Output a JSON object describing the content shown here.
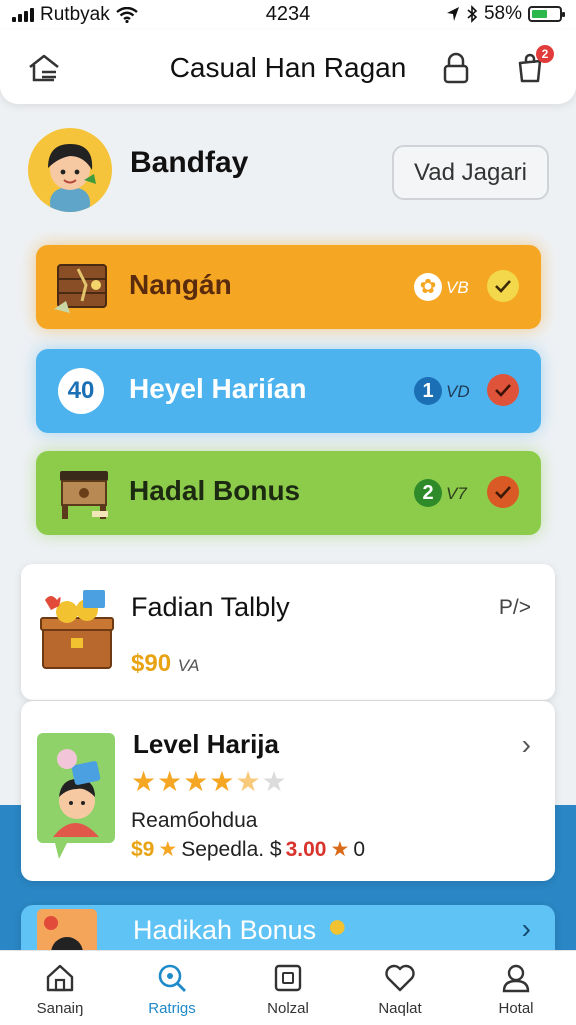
{
  "status_bar": {
    "carrier": "Rutbyak",
    "time": "4234",
    "battery": "58%",
    "battery_level": 0.58
  },
  "header": {
    "title": "Casual Han Ragan",
    "notification_count": "2"
  },
  "user": {
    "name": "Bandfay",
    "action_button": "Vad Jagari"
  },
  "quests": [
    {
      "label": "Nangán",
      "number": "",
      "suffix": "VB",
      "check_color": "#f2d84a",
      "color": "#f5a623"
    },
    {
      "label": "Heyel Hariían",
      "badge": "40",
      "number": "1",
      "suffix": "VD",
      "check_color": "#e0533b",
      "color": "#4db3ee"
    },
    {
      "label": "Hadal Bonus",
      "number": "2",
      "suffix": "V7",
      "check_color": "#d95a24",
      "color": "#8ccc4a"
    }
  ],
  "cards": [
    {
      "title": "Fadian Talbly",
      "price": "$90",
      "price_suffix": "VA",
      "right_label": "P/>"
    },
    {
      "title": "Level Harija",
      "rating": 4.5,
      "rating_max": 6,
      "subtitle": "Reamбohdua",
      "price_left": "$9",
      "price_mid": "Sepedla. $",
      "price_red": "3.00",
      "price_right": "0"
    },
    {
      "title": "Hadikah Bonus"
    }
  ],
  "nav": [
    {
      "label": "Sanaiŋ",
      "icon": "home-icon"
    },
    {
      "label": "Ratrigs",
      "icon": "search-icon",
      "active": true
    },
    {
      "label": "Nolzal",
      "icon": "square-icon"
    },
    {
      "label": "Naqlat",
      "icon": "heart-icon"
    },
    {
      "label": "Hotal",
      "icon": "user-icon"
    }
  ]
}
